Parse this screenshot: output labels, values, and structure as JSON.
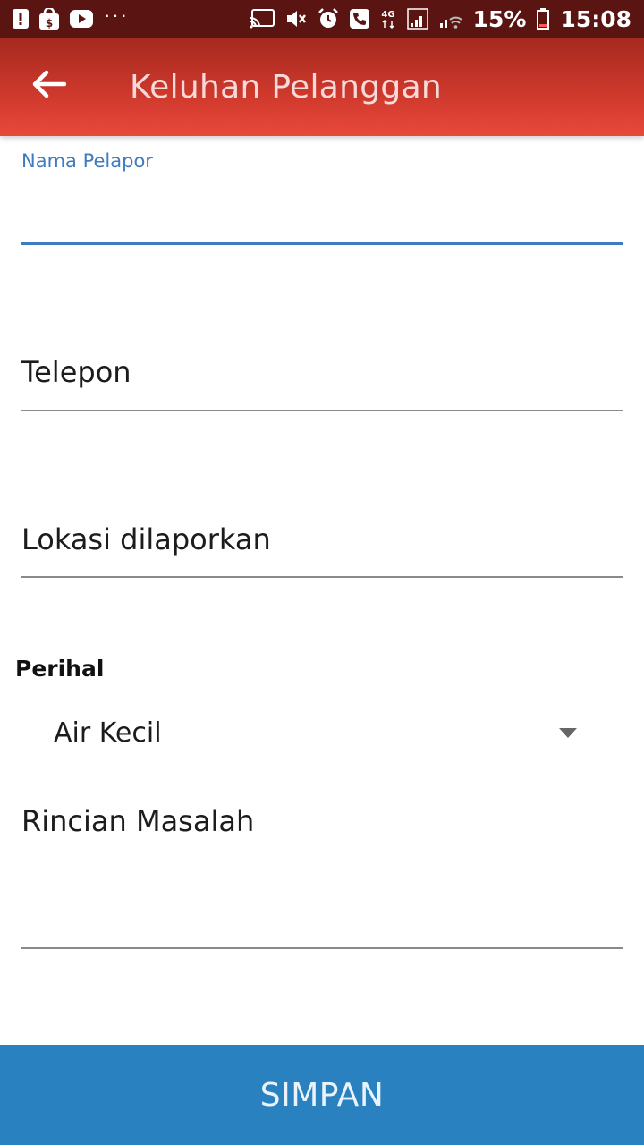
{
  "status_bar": {
    "left_icons": [
      "alert-icon",
      "shopping-bag-icon",
      "youtube-icon",
      "more-dots-icon"
    ],
    "dots": "···",
    "right_icons": [
      "cast-icon",
      "mute-icon",
      "alarm-icon",
      "call-icon",
      "network-4g-icon",
      "signal-icon",
      "wifi-icon"
    ],
    "battery_percent": "15%",
    "time": "15:08"
  },
  "app_bar": {
    "title": "Keluhan Pelanggan",
    "back_icon": "back-arrow-icon"
  },
  "form": {
    "nama_pelapor": {
      "label": "Nama Pelapor",
      "value": ""
    },
    "telepon": {
      "placeholder": "Telepon",
      "value": ""
    },
    "lokasi": {
      "placeholder": "Lokasi dilaporkan",
      "value": ""
    },
    "perihal": {
      "label": "Perihal",
      "selected": "Air Kecil"
    },
    "rincian": {
      "placeholder": "Rincian Masalah",
      "value": ""
    }
  },
  "actions": {
    "submit_label": "SIMPAN"
  },
  "colors": {
    "status_bar": "#5a1512",
    "app_bar": "#c9362a",
    "accent": "#3f7bbf",
    "submit": "#2a81c0"
  }
}
